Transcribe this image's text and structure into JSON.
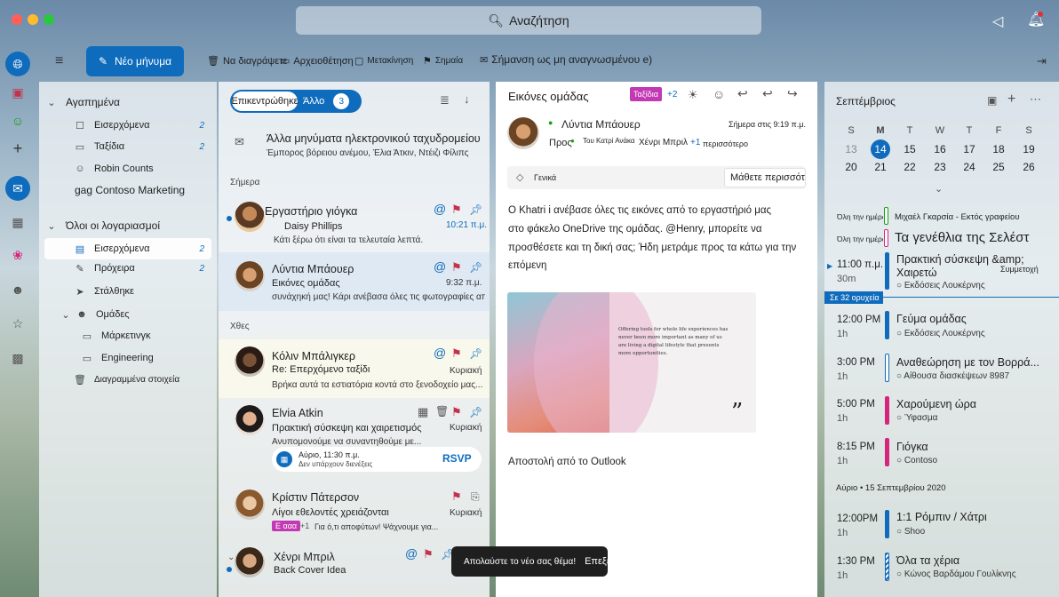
{
  "search": {
    "placeholder": "Αναζήτηση"
  },
  "toolbar": {
    "new_message": "Νέο μήνυμα",
    "delete": "Να διαγράψετε",
    "archive": "Αρχειοθέτηση",
    "move": "Μετακίνηση",
    "flag": "Σημαία",
    "mark_unread": "Σήμανση ως μη αναγνωσμένου e)"
  },
  "folders": {
    "favorites_header": "Αγαπημένα",
    "favorites": [
      {
        "label": "Εισερχόμενα",
        "count": "2",
        "icon": "inbox-icon"
      },
      {
        "label": "Ταξίδια",
        "count": "2",
        "icon": "folder-icon"
      },
      {
        "label": "Robin Counts",
        "count": "",
        "icon": "person-icon"
      },
      {
        "label": "gag Contoso Marketing",
        "count": "",
        "icon": ""
      }
    ],
    "all_accounts_header": "Όλοι οι λογαριασμοί",
    "accounts": [
      {
        "label": "Εισερχόμενα",
        "count": "2",
        "icon": "inbox-icon"
      },
      {
        "label": "Πρόχειρα",
        "count": "2",
        "icon": "draft-icon"
      },
      {
        "label": "Στάλθηκε",
        "count": "",
        "icon": "sent-icon"
      },
      {
        "label": "Ομάδες",
        "count": "",
        "icon": "groups-icon"
      },
      {
        "label": "Μάρκετινγκ",
        "count": "",
        "icon": "folder-icon"
      },
      {
        "label": "Engineering",
        "count": "",
        "icon": "folder-icon"
      },
      {
        "label": "Διαγραμμένα στοιχεία",
        "count": "",
        "icon": "trash-icon"
      }
    ]
  },
  "list": {
    "focused_tab": "Επικεντρώθηκε",
    "other_tab": "Άλλο",
    "other_count": "3",
    "other_mail_title": "Άλλα μηνύματα ηλεκτρονικού ταχυδρομείου",
    "other_mail_preview": "Έμπορος βόρειου ανέμου, Έλια Άτκιν, Ντέιζι Φίλιπς",
    "today_label": "Σήμερα",
    "yesterday_label": "Χθες",
    "messages": [
      {
        "sender": "Εργαστήριο γιόγκα",
        "subject": "Daisy Phillips",
        "preview": "Κάτι ξέρω ότι είναι τα τελευταία λεπτά.",
        "time": "10:21 π.μ."
      },
      {
        "sender": "Λύντια Μπάουερ",
        "subject": "Εικόνες ομάδας",
        "preview": "συνάχηκή μας! Κάρι ανέβασα όλες τις φωτογραφίες από...",
        "time": "9:32 π.μ."
      },
      {
        "sender": "Κόλιν Μπάλιγκερ",
        "subject": "Re: Επερχόμενο ταξίδι",
        "preview": "Βρήκα αυτά τα εστιατόρια κοντά στο ξενοδοχείο μας...",
        "time": "Κυριακή"
      },
      {
        "sender": "Elvia Atkin",
        "subject": "Πρακτική σύσκεψη και χαιρετισμός",
        "preview": "Ανυπομονούμε να συναντηθούμε με...",
        "time": "Κυριακή",
        "event_time": "Αύριο, 11:30 π.μ.",
        "event_note": "Δεν υπάρχουν διενέξεις",
        "rsvp": "RSVP"
      },
      {
        "sender": "Κρίστιν Πάτερσον",
        "subject": "Λίγοι εθελοντές χρειάζονται",
        "preview": "Για ό,τι αποφύτων! Ψάχνουμε για...",
        "time": "Κυριακή",
        "tag": "Ε ααα",
        "extra": "+1"
      },
      {
        "sender": "Χένρι Μπριλ",
        "subject": "Back Cover Idea",
        "preview": "",
        "time": ""
      }
    ]
  },
  "reading": {
    "subject": "Εικόνες ομάδας",
    "tag": "Ταξίδια",
    "tag_extra": "+2",
    "sender": "Λύντια Μπάουερ",
    "date": "Σήμερα στις 9:19 π.μ.",
    "to_label": "Προς",
    "to_1": "Του Κατρί Ανάκα",
    "to_2": "Χένρι Μπριλ",
    "to_more": "+1",
    "to_more_label": "περισσότερο",
    "category": "Γενικά",
    "learn_more": "Μάθετε περισσότερα",
    "body_1": "Ο Khatri i ανέβασε όλες τις εικόνες από το εργαστήριό μας",
    "body_2": "στο φάκελο OneDrive της ομάδας. @Henry, μπορείτε να",
    "body_3": "προσθέσετε και τη δική σας; Ήδη μετράμε προς τα κάτω για την",
    "body_4": "επόμενη",
    "image_text": "Offering tools for whole life experiences has never been more important as many of us are living a digital lifestyle that presents more opportunities.",
    "signature": "Αποστολή από το Outlook"
  },
  "calendar": {
    "month": "Σεπτέμβριος",
    "dow": [
      "S",
      "M",
      "T",
      "W",
      "T",
      "F",
      "S"
    ],
    "week1": [
      "13",
      "14",
      "15",
      "16",
      "17",
      "18",
      "19"
    ],
    "week2": [
      "20",
      "21",
      "22",
      "23",
      "24",
      "25",
      "26"
    ],
    "all_day_1_label": "Όλη την ημέρα",
    "all_day_1_title": "Μιχαέλ Γκαρσία - Εκτός γραφείου",
    "all_day_2_label": "Όλη την ημέρα",
    "all_day_2_title": "Τα γενέθλια της Σελέστ",
    "now_label": "Σε 32 ορυχεία",
    "events": [
      {
        "time": "11:00 π.μ.",
        "dur": "30m",
        "title": "Πρακτική σύσκεψη &amp; Χαιρετώ",
        "extra": "Συμμετοχή",
        "loc": "Εκδόσεις Λουκέρνης",
        "color": "#0f6cbd"
      },
      {
        "time": "12:00 PM",
        "dur": "1h",
        "title": "Γεύμα ομάδας",
        "loc": "Εκδόσεις Λουκέρνης",
        "color": "#0f6cbd"
      },
      {
        "time": "3:00 PM",
        "dur": "1h",
        "title": "Αναθεώρηση με τον Βορρά...",
        "loc": "Αίθουσα διασκέψεων 8987",
        "color": "#0f6cbd"
      },
      {
        "time": "5:00 PM",
        "dur": "1h",
        "title": "Χαρούμενη ώρα",
        "loc": "Ύφασμα",
        "color": "#d6247e"
      },
      {
        "time": "8:15 PM",
        "dur": "1h",
        "title": "Γιόγκα",
        "loc": "Contoso",
        "color": "#d6247e"
      }
    ],
    "tomorrow_label": "Αύριο • 15 Σεπτεμβρίου 2020",
    "tomorrow_events": [
      {
        "time": "12:00PM",
        "dur": "1h",
        "title": "1:1 Ρόμπιν / Χάτρι",
        "loc": "Shoo",
        "color": "#0f6cbd"
      },
      {
        "time": "1:30 PM",
        "dur": "1h",
        "title": "Όλα τα χέρια",
        "loc": "Κώνος Βαρδάμου Γουλίκνης",
        "color": "#0f6cbd"
      }
    ]
  },
  "toast": {
    "text": "Απολαύστε το νέο σας θέμα!",
    "action": "Επεξεργασία"
  }
}
